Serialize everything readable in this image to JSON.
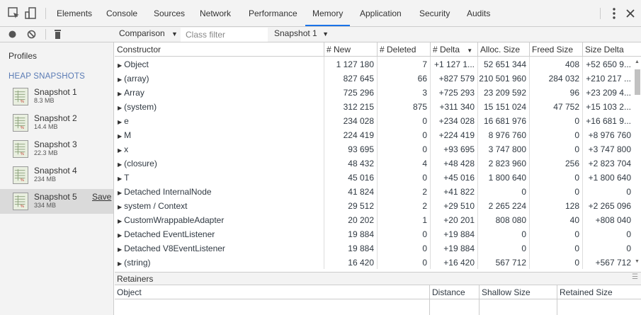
{
  "tabs": [
    "Elements",
    "Console",
    "Sources",
    "Network",
    "Performance",
    "Memory",
    "Application",
    "Security",
    "Audits"
  ],
  "selected_tab": "Memory",
  "toolbar": {
    "view_mode": "Comparison",
    "class_filter_placeholder": "Class filter",
    "baseline": "Snapshot 1"
  },
  "sidebar": {
    "title": "Profiles",
    "section": "HEAP SNAPSHOTS",
    "snapshots": [
      {
        "name": "Snapshot 1",
        "size": "8.3 MB"
      },
      {
        "name": "Snapshot 2",
        "size": "14.4 MB"
      },
      {
        "name": "Snapshot 3",
        "size": "22.3 MB"
      },
      {
        "name": "Snapshot 4",
        "size": "234 MB"
      },
      {
        "name": "Snapshot 5",
        "size": "334 MB",
        "save": "Save"
      }
    ]
  },
  "table": {
    "columns": [
      "Constructor",
      "# New",
      "# Deleted",
      "# Delta",
      "Alloc. Size",
      "Freed Size",
      "Size Delta"
    ],
    "rows": [
      [
        "Object",
        "1 127 180",
        "7",
        "+1 127 1...",
        "52 651 344",
        "408",
        "+52 650 9..."
      ],
      [
        "(array)",
        "827 645",
        "66",
        "+827 579",
        "210 501 960",
        "284 032",
        "+210 217 ..."
      ],
      [
        "Array",
        "725 296",
        "3",
        "+725 293",
        "23 209 592",
        "96",
        "+23 209 4..."
      ],
      [
        "(system)",
        "312 215",
        "875",
        "+311 340",
        "15 151 024",
        "47 752",
        "+15 103 2..."
      ],
      [
        "e",
        "234 028",
        "0",
        "+234 028",
        "16 681 976",
        "0",
        "+16 681 9..."
      ],
      [
        "M",
        "224 419",
        "0",
        "+224 419",
        "8 976 760",
        "0",
        "+8 976 760"
      ],
      [
        "x",
        "93 695",
        "0",
        "+93 695",
        "3 747 800",
        "0",
        "+3 747 800"
      ],
      [
        "(closure)",
        "48 432",
        "4",
        "+48 428",
        "2 823 960",
        "256",
        "+2 823 704"
      ],
      [
        "T",
        "45 016",
        "0",
        "+45 016",
        "1 800 640",
        "0",
        "+1 800 640"
      ],
      [
        "Detached InternalNode",
        "41 824",
        "2",
        "+41 822",
        "0",
        "0",
        "0"
      ],
      [
        "system / Context",
        "29 512",
        "2",
        "+29 510",
        "2 265 224",
        "128",
        "+2 265 096"
      ],
      [
        "CustomWrappableAdapter",
        "20 202",
        "1",
        "+20 201",
        "808 080",
        "40",
        "+808 040"
      ],
      [
        "Detached EventListener",
        "19 884",
        "0",
        "+19 884",
        "0",
        "0",
        "0"
      ],
      [
        "Detached V8EventListener",
        "19 884",
        "0",
        "+19 884",
        "0",
        "0",
        "0"
      ],
      [
        "(string)",
        "16 420",
        "0",
        "+16 420",
        "567 712",
        "0",
        "+567 712"
      ]
    ]
  },
  "retainers": {
    "title": "Retainers",
    "columns": [
      "Object",
      "Distance",
      "Shallow Size",
      "Retained Size"
    ]
  }
}
